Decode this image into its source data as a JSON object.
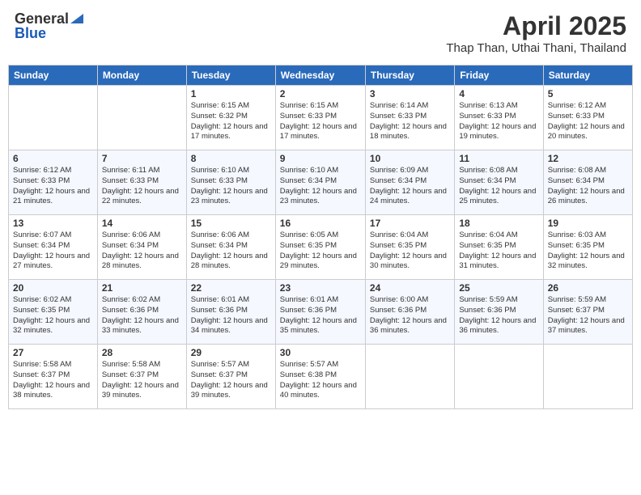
{
  "logo": {
    "general": "General",
    "blue": "Blue"
  },
  "title": "April 2025",
  "location": "Thap Than, Uthai Thani, Thailand",
  "days_of_week": [
    "Sunday",
    "Monday",
    "Tuesday",
    "Wednesday",
    "Thursday",
    "Friday",
    "Saturday"
  ],
  "weeks": [
    [
      {
        "day": "",
        "info": ""
      },
      {
        "day": "",
        "info": ""
      },
      {
        "day": "1",
        "info": "Sunrise: 6:15 AM\nSunset: 6:32 PM\nDaylight: 12 hours and 17 minutes."
      },
      {
        "day": "2",
        "info": "Sunrise: 6:15 AM\nSunset: 6:33 PM\nDaylight: 12 hours and 17 minutes."
      },
      {
        "day": "3",
        "info": "Sunrise: 6:14 AM\nSunset: 6:33 PM\nDaylight: 12 hours and 18 minutes."
      },
      {
        "day": "4",
        "info": "Sunrise: 6:13 AM\nSunset: 6:33 PM\nDaylight: 12 hours and 19 minutes."
      },
      {
        "day": "5",
        "info": "Sunrise: 6:12 AM\nSunset: 6:33 PM\nDaylight: 12 hours and 20 minutes."
      }
    ],
    [
      {
        "day": "6",
        "info": "Sunrise: 6:12 AM\nSunset: 6:33 PM\nDaylight: 12 hours and 21 minutes."
      },
      {
        "day": "7",
        "info": "Sunrise: 6:11 AM\nSunset: 6:33 PM\nDaylight: 12 hours and 22 minutes."
      },
      {
        "day": "8",
        "info": "Sunrise: 6:10 AM\nSunset: 6:33 PM\nDaylight: 12 hours and 23 minutes."
      },
      {
        "day": "9",
        "info": "Sunrise: 6:10 AM\nSunset: 6:34 PM\nDaylight: 12 hours and 23 minutes."
      },
      {
        "day": "10",
        "info": "Sunrise: 6:09 AM\nSunset: 6:34 PM\nDaylight: 12 hours and 24 minutes."
      },
      {
        "day": "11",
        "info": "Sunrise: 6:08 AM\nSunset: 6:34 PM\nDaylight: 12 hours and 25 minutes."
      },
      {
        "day": "12",
        "info": "Sunrise: 6:08 AM\nSunset: 6:34 PM\nDaylight: 12 hours and 26 minutes."
      }
    ],
    [
      {
        "day": "13",
        "info": "Sunrise: 6:07 AM\nSunset: 6:34 PM\nDaylight: 12 hours and 27 minutes."
      },
      {
        "day": "14",
        "info": "Sunrise: 6:06 AM\nSunset: 6:34 PM\nDaylight: 12 hours and 28 minutes."
      },
      {
        "day": "15",
        "info": "Sunrise: 6:06 AM\nSunset: 6:34 PM\nDaylight: 12 hours and 28 minutes."
      },
      {
        "day": "16",
        "info": "Sunrise: 6:05 AM\nSunset: 6:35 PM\nDaylight: 12 hours and 29 minutes."
      },
      {
        "day": "17",
        "info": "Sunrise: 6:04 AM\nSunset: 6:35 PM\nDaylight: 12 hours and 30 minutes."
      },
      {
        "day": "18",
        "info": "Sunrise: 6:04 AM\nSunset: 6:35 PM\nDaylight: 12 hours and 31 minutes."
      },
      {
        "day": "19",
        "info": "Sunrise: 6:03 AM\nSunset: 6:35 PM\nDaylight: 12 hours and 32 minutes."
      }
    ],
    [
      {
        "day": "20",
        "info": "Sunrise: 6:02 AM\nSunset: 6:35 PM\nDaylight: 12 hours and 32 minutes."
      },
      {
        "day": "21",
        "info": "Sunrise: 6:02 AM\nSunset: 6:36 PM\nDaylight: 12 hours and 33 minutes."
      },
      {
        "day": "22",
        "info": "Sunrise: 6:01 AM\nSunset: 6:36 PM\nDaylight: 12 hours and 34 minutes."
      },
      {
        "day": "23",
        "info": "Sunrise: 6:01 AM\nSunset: 6:36 PM\nDaylight: 12 hours and 35 minutes."
      },
      {
        "day": "24",
        "info": "Sunrise: 6:00 AM\nSunset: 6:36 PM\nDaylight: 12 hours and 36 minutes."
      },
      {
        "day": "25",
        "info": "Sunrise: 5:59 AM\nSunset: 6:36 PM\nDaylight: 12 hours and 36 minutes."
      },
      {
        "day": "26",
        "info": "Sunrise: 5:59 AM\nSunset: 6:37 PM\nDaylight: 12 hours and 37 minutes."
      }
    ],
    [
      {
        "day": "27",
        "info": "Sunrise: 5:58 AM\nSunset: 6:37 PM\nDaylight: 12 hours and 38 minutes."
      },
      {
        "day": "28",
        "info": "Sunrise: 5:58 AM\nSunset: 6:37 PM\nDaylight: 12 hours and 39 minutes."
      },
      {
        "day": "29",
        "info": "Sunrise: 5:57 AM\nSunset: 6:37 PM\nDaylight: 12 hours and 39 minutes."
      },
      {
        "day": "30",
        "info": "Sunrise: 5:57 AM\nSunset: 6:38 PM\nDaylight: 12 hours and 40 minutes."
      },
      {
        "day": "",
        "info": ""
      },
      {
        "day": "",
        "info": ""
      },
      {
        "day": "",
        "info": ""
      }
    ]
  ]
}
